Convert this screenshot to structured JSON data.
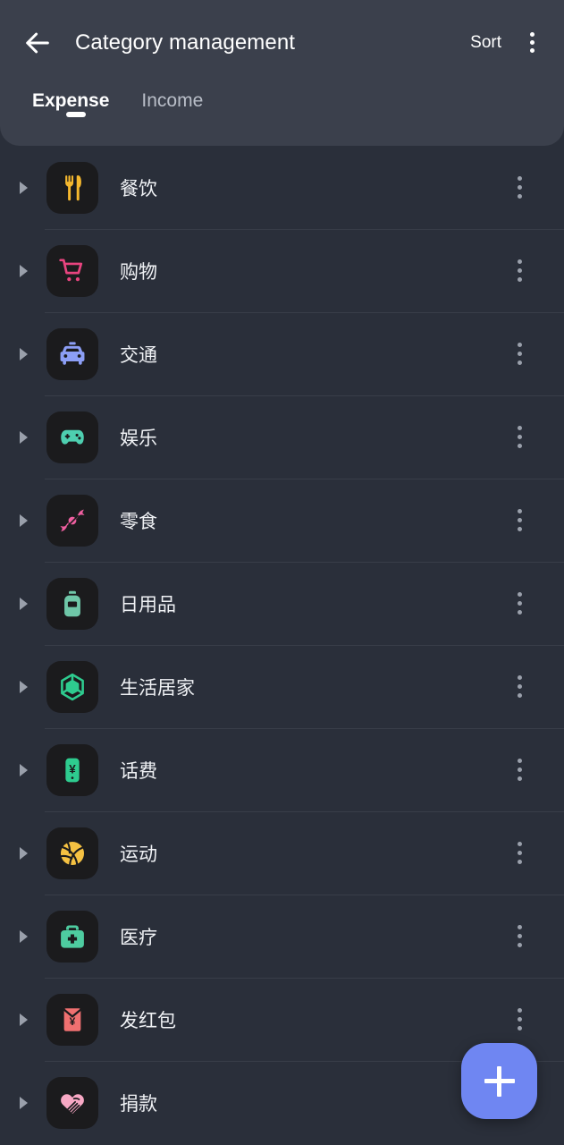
{
  "header": {
    "back_icon": "arrow-left-icon",
    "title": "Category management",
    "sort_label": "Sort",
    "overflow_icon": "more-vert-icon"
  },
  "tabs": [
    {
      "label": "Expense",
      "active": true
    },
    {
      "label": "Income",
      "active": false
    }
  ],
  "colors": {
    "background": "#2a2f3a",
    "appbar": "#3b404c",
    "divider": "#383d48",
    "tile": "#1b1b1d",
    "text_primary": "#f0f2f5",
    "text_secondary": "#b9bec8",
    "fab": "#6f86f2",
    "caret": "#9aa0ab"
  },
  "list": {
    "expander_icon": "caret-right-icon",
    "row_menu_icon": "more-vert-icon",
    "rows": [
      {
        "label": "餐饮",
        "icon": "fork-knife-icon",
        "icon_color": "#f5b82e"
      },
      {
        "label": "购物",
        "icon": "shopping-cart-icon",
        "icon_color": "#e8447f"
      },
      {
        "label": "交通",
        "icon": "taxi-car-icon",
        "icon_color": "#8c9ef5"
      },
      {
        "label": "娱乐",
        "icon": "gamepad-icon",
        "icon_color": "#4ecfb0"
      },
      {
        "label": "零食",
        "icon": "candy-icon",
        "icon_color": "#ef5fa0"
      },
      {
        "label": "日用品",
        "icon": "detergent-bottle-icon",
        "icon_color": "#6fc7a8"
      },
      {
        "label": "生活居家",
        "icon": "cube-hexagon-icon",
        "icon_color": "#2ecc8f"
      },
      {
        "label": "话费",
        "icon": "phone-yuan-icon",
        "icon_color": "#2ecc8f"
      },
      {
        "label": "运动",
        "icon": "basketball-icon",
        "icon_color": "#f5c142"
      },
      {
        "label": "医疗",
        "icon": "medical-bag-icon",
        "icon_color": "#4ecca0"
      },
      {
        "label": "发红包",
        "icon": "red-envelope-icon",
        "icon_color": "#f07070"
      },
      {
        "label": "捐款",
        "icon": "heart-hand-icon",
        "icon_color": "#f7a8c4"
      }
    ]
  },
  "fab": {
    "icon": "plus-icon",
    "label": "add-category"
  }
}
